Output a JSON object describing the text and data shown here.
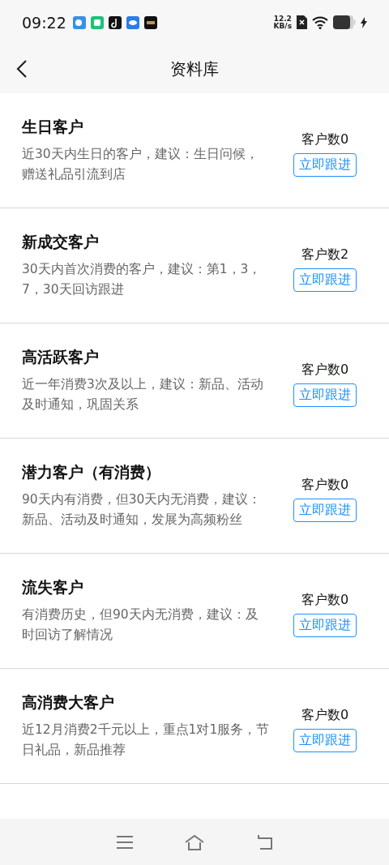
{
  "status_bar": {
    "time": "09:22",
    "network_speed": "12.2",
    "network_unit": "KB/s"
  },
  "header": {
    "title": "资料库"
  },
  "items": [
    {
      "title": "生日客户",
      "description": "近30天内生日的客户，建议：生日问候，赠送礼品引流到店",
      "count": "客户数0",
      "action": "立即跟进"
    },
    {
      "title": "新成交客户",
      "description": "30天内首次消费的客户，建议：第1，3，7，30天回访跟进",
      "count": "客户数2",
      "action": "立即跟进"
    },
    {
      "title": "高活跃客户",
      "description": "近一年消费3次及以上，建议：新品、活动及时通知，巩固关系",
      "count": "客户数0",
      "action": "立即跟进"
    },
    {
      "title": "潜力客户（有消费）",
      "description": "90天内有消费，但30天内无消费，建议：新品、活动及时通知，发展为高频粉丝",
      "count": "客户数0",
      "action": "立即跟进"
    },
    {
      "title": "流失客户",
      "description": "有消费历史，但90天内无消费，建议：及时回访了解情况",
      "count": "客户数0",
      "action": "立即跟进"
    },
    {
      "title": "高消费大客户",
      "description": "近12月消费2千元以上，重点1对1服务，节日礼品，新品推荐",
      "count": "客户数0",
      "action": "立即跟进"
    }
  ]
}
